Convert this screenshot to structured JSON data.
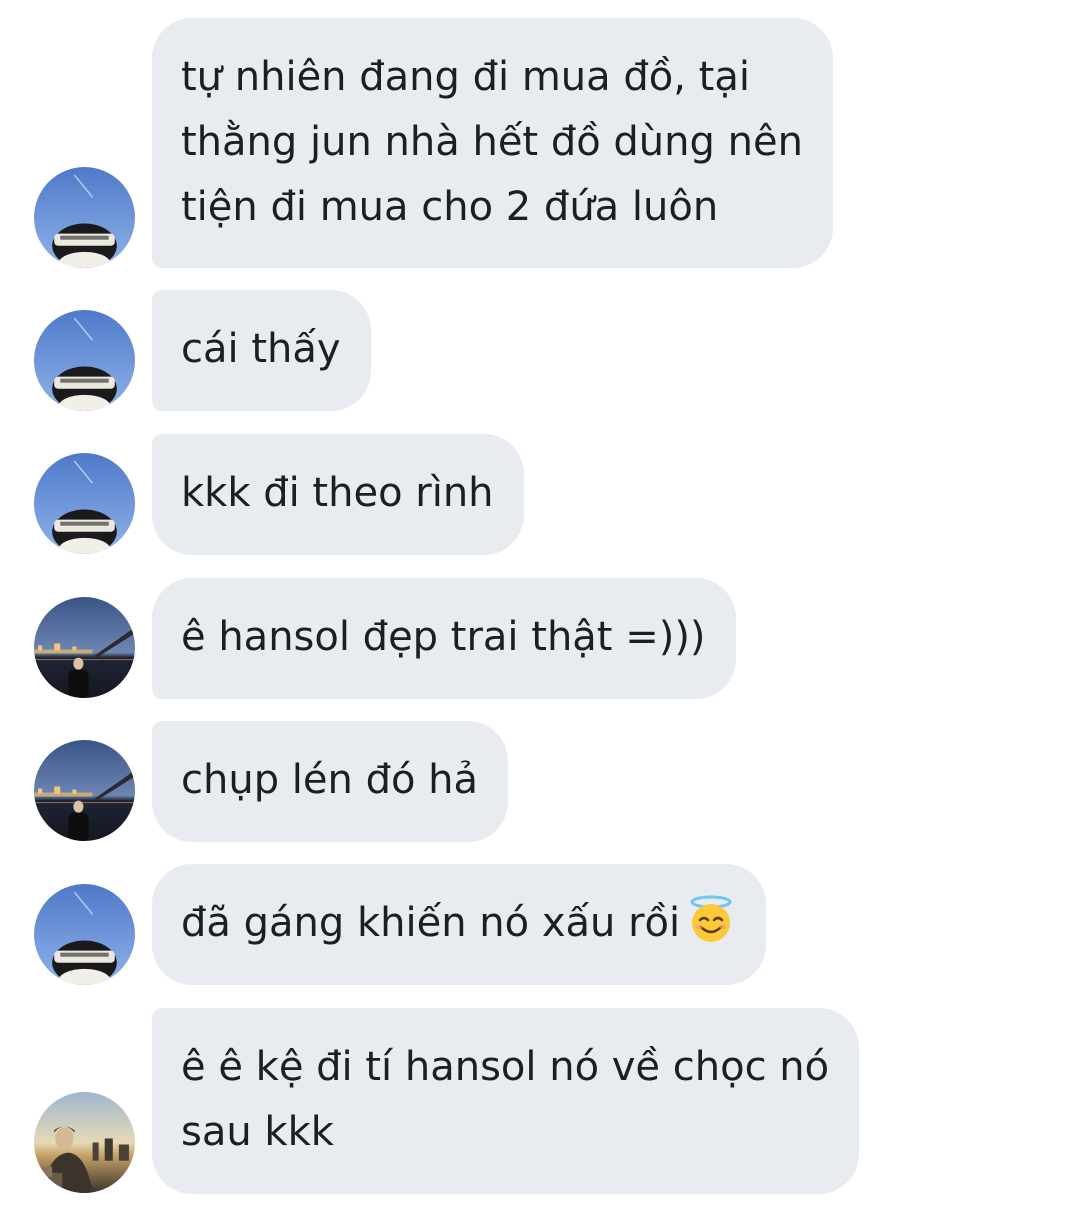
{
  "messages": [
    {
      "sender": "sky-avatar",
      "lines": [
        "tự nhiên đang đi mua đồ, tại",
        "thằng jun nhà hết đồ dùng nên",
        "tiện đi mua cho 2 đứa luôn"
      ]
    },
    {
      "sender": "sky-avatar",
      "lines": [
        "cái thấy"
      ]
    },
    {
      "sender": "sky-avatar",
      "lines": [
        "kkk đi theo rình"
      ]
    },
    {
      "sender": "night-city-avatar",
      "lines": [
        "ê hansol đẹp trai thật =)))"
      ]
    },
    {
      "sender": "night-city-avatar",
      "lines": [
        "chụp lén đó hả"
      ]
    },
    {
      "sender": "sky-avatar",
      "lines": [
        "đã gáng khiến nó xấu rồi"
      ],
      "emoji": "smiling-face-with-halo-icon"
    },
    {
      "sender": "sunset-avatar",
      "lines": [
        "ê ê kệ đi tí hansol nó về chọc nó",
        "sau kkk"
      ]
    }
  ],
  "colors": {
    "bubble": "#e8ebf0",
    "text": "#1c1e21",
    "background": "#ffffff"
  }
}
